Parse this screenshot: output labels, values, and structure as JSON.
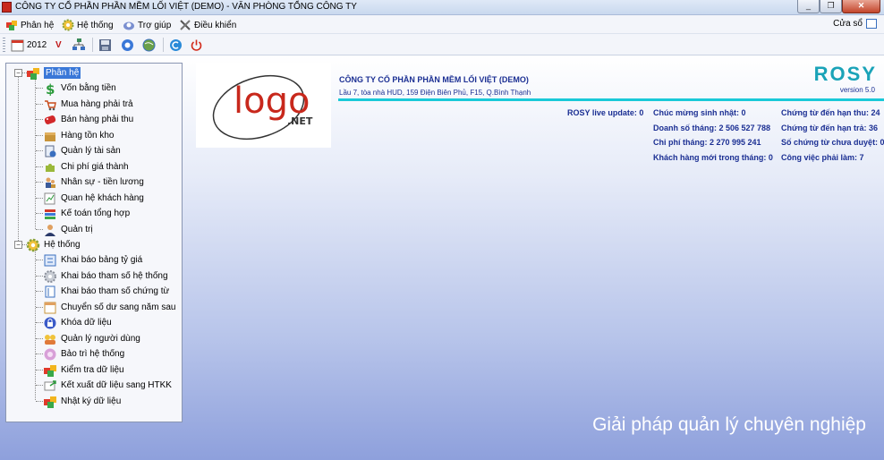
{
  "window": {
    "title": "CÔNG TY CỔ PHẦN PHẦN MỀM LỐI VIỆT (DEMO) - VĂN PHÒNG TỔNG CÔNG TY",
    "controls": {
      "minimize": "_",
      "restore": "❐",
      "close": "✕"
    }
  },
  "menu": {
    "items": [
      {
        "label": "Phân hệ",
        "icon": "heart-cubes-icon"
      },
      {
        "label": "Hệ thống",
        "icon": "gear-icon"
      },
      {
        "label": "Trợ giúp",
        "icon": "help-icon"
      },
      {
        "label": "Điều khiển",
        "icon": "tools-icon"
      }
    ],
    "windows_label": "Cửa sổ"
  },
  "toolbar": {
    "year": "2012",
    "v_label": "V",
    "icons": [
      "calendar-icon",
      "network-icon",
      "save-icon",
      "refresh-icon",
      "globe-icon",
      "back-icon",
      "power-icon"
    ]
  },
  "tree": {
    "groups": [
      {
        "label": "Phân hệ",
        "selected": true,
        "items": [
          {
            "label": "Vốn bằng tiền",
            "icon": "dollar-icon"
          },
          {
            "label": "Mua hàng phải trả",
            "icon": "cart-icon"
          },
          {
            "label": "Bán hàng phải thu",
            "icon": "sale-tag-icon"
          },
          {
            "label": "Hàng tồn kho",
            "icon": "box-icon"
          },
          {
            "label": "Quản lý tài sản",
            "icon": "asset-icon"
          },
          {
            "label": "Chi phí giá thành",
            "icon": "puzzle-icon"
          },
          {
            "label": "Nhân sự - tiền lương",
            "icon": "people-icon"
          },
          {
            "label": "Quan hệ khách hàng",
            "icon": "chart-pencil-icon"
          },
          {
            "label": "Kế toán tổng hợp",
            "icon": "books-icon"
          },
          {
            "label": "Quản trị",
            "icon": "admin-icon"
          }
        ]
      },
      {
        "label": "Hệ thống",
        "selected": false,
        "items": [
          {
            "label": "Khai báo bảng tỷ giá",
            "icon": "exchange-icon"
          },
          {
            "label": "Khai báo tham số hệ thống",
            "icon": "settings-icon"
          },
          {
            "label": "Khai báo tham số chứng từ",
            "icon": "document-icon"
          },
          {
            "label": "Chuyển số dư sang năm sau",
            "icon": "calendar-move-icon"
          },
          {
            "label": "Khóa dữ liệu",
            "icon": "lock-icon"
          },
          {
            "label": "Quản lý người dùng",
            "icon": "users-icon"
          },
          {
            "label": "Bảo trì hệ thống",
            "icon": "maintenance-icon"
          },
          {
            "label": "Kiểm tra dữ liệu",
            "icon": "check-cubes-icon"
          },
          {
            "label": "Kết xuất dữ liệu sang HTKK",
            "icon": "export-icon"
          },
          {
            "label": "Nhật ký dữ liệu",
            "icon": "log-cubes-icon"
          }
        ]
      }
    ]
  },
  "logo": {
    "text_logo": "logo",
    "text_net": ".NET"
  },
  "header": {
    "company": "CÔNG TY CỔ PHẦN PHẦN MỀM LỐI VIỆT (DEMO)",
    "address": "Lầu 7, tòa nhà HUD, 159 Điện Biên Phủ, F15, Q.Bình Thạnh",
    "brand": "ROSY",
    "version": "version 5.0"
  },
  "stats": {
    "live_update": "ROSY live update: 0",
    "col2": [
      "Chúc mừng sinh nhật: 0",
      "Doanh số tháng: 2 506 527 788",
      "Chi phí tháng: 2 270 995 241",
      "Khách hàng mới trong tháng: 0"
    ],
    "col3": [
      "Chứng từ đến hạn thu: 24",
      "Chứng từ đến hạn trả: 36",
      "Số chứng từ chưa duyệt: 0",
      "Công việc phải làm: 7"
    ]
  },
  "slogan": "Giải pháp quản lý chuyên nghiệp",
  "colors": {
    "brand": "#1aa3b8",
    "header_text": "#1b2f93",
    "accent_line": "#19c9d8",
    "selection": "#3a78d8"
  }
}
